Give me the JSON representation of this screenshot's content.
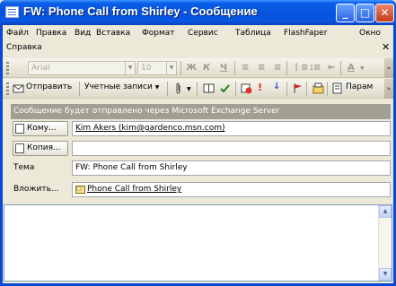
{
  "window": {
    "title": "FW: Phone Call from Shirley - Сообщение",
    "controls": {
      "minimize": "_",
      "maximize": "□",
      "close": "✕"
    }
  },
  "menu": {
    "items": [
      "Файл",
      "Правка",
      "Вид",
      "Вставка",
      "Формат",
      "Сервис",
      "Таблица",
      "FlashFaper",
      "Окно",
      "Справка"
    ],
    "close": "✕"
  },
  "format_toolbar": {
    "font": "Arial",
    "size": "10",
    "bold": "Ж",
    "italic": "К",
    "underline": "Ч",
    "font_color": "A"
  },
  "standard_toolbar": {
    "send": "Отправить",
    "accounts": "Учетные записи",
    "params": "Парам"
  },
  "info_bar": "Сообщение будет отправлено через Microsoft Exchange Server",
  "fields": {
    "to_label": "Кому...",
    "to_value": "Kim Akers (kim@gardenco.msn.com)",
    "cc_label": "Копия...",
    "cc_value": "",
    "subject_label": "Тема",
    "subject_value": "FW: Phone Call from Shirley",
    "attach_label": "Вложить...",
    "attach_value": "Phone Call from Shirley"
  },
  "icons": {
    "send": "send-icon",
    "attach": "paperclip-icon",
    "address_book": "address-book-icon",
    "check_names": "check-names-icon",
    "permission": "permission-icon",
    "importance_high": "importance-high-icon",
    "importance_low": "importance-low-icon",
    "flag": "flag-icon",
    "options": "options-icon"
  },
  "colors": {
    "titlebar": "#0753dd",
    "info_bar": "#a19f91",
    "window_bg": "#ece9d8"
  }
}
